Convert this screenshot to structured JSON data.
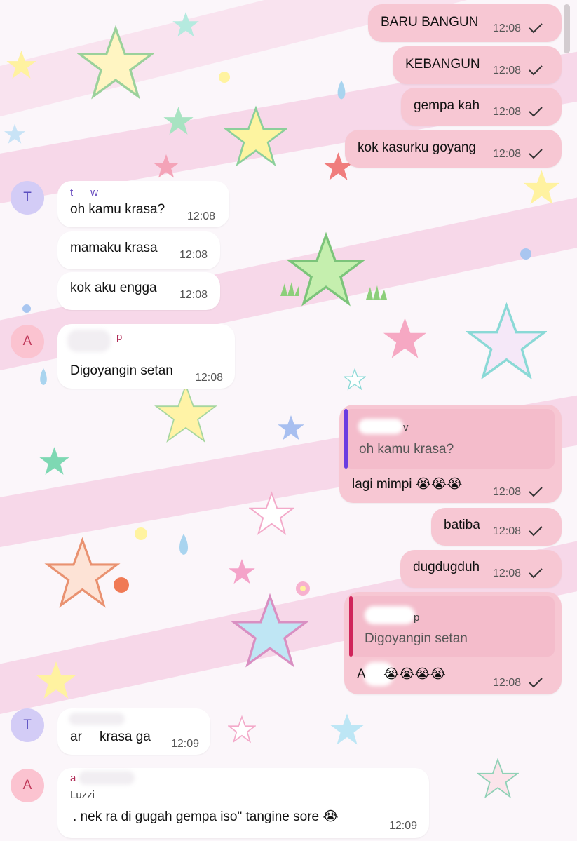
{
  "colors": {
    "outgoing_bubble": "#f7c7d3",
    "incoming_bubble": "#ffffff",
    "quote_bar_1": "#6b3ce0",
    "quote_bar_2": "#d0245a",
    "avatar_t": "#d3ccf6",
    "avatar_a": "#fbc3d0"
  },
  "messages": [
    {
      "id": "m1",
      "direction": "out",
      "text": "BARU BANGUN",
      "time": "12:08",
      "status": "sent-check-icon"
    },
    {
      "id": "m2",
      "direction": "out",
      "text": "KEBANGUN",
      "time": "12:08",
      "status": "sent-check-icon"
    },
    {
      "id": "m3",
      "direction": "out",
      "text": "gempa kah",
      "time": "12:08",
      "status": "sent-check-icon"
    },
    {
      "id": "m4",
      "direction": "out",
      "text": "kok kasurku goyang",
      "time": "12:08",
      "status": "sent-check-icon"
    },
    {
      "id": "m5",
      "direction": "in",
      "avatar": "T",
      "sender": "t      w",
      "text": "oh kamu krasa?",
      "time": "12:08"
    },
    {
      "id": "m6",
      "direction": "in",
      "text": "mamaku krasa",
      "time": "12:08"
    },
    {
      "id": "m7",
      "direction": "in",
      "text": "kok aku engga",
      "time": "12:08"
    },
    {
      "id": "m8",
      "direction": "in",
      "avatar": "A",
      "sender": "p",
      "text": "Digoyangin setan",
      "time": "12:08"
    },
    {
      "id": "m9",
      "direction": "out",
      "quote": {
        "sender": "v",
        "text": "oh kamu krasa?"
      },
      "text": "lagi mimpi 😭😭😭",
      "time": "12:08",
      "status": "sent-check-icon"
    },
    {
      "id": "m10",
      "direction": "out",
      "text": "batiba",
      "time": "12:08",
      "status": "sent-check-icon"
    },
    {
      "id": "m11",
      "direction": "out",
      "text": "dugdugduh",
      "time": "12:08",
      "status": "sent-check-icon"
    },
    {
      "id": "m12",
      "direction": "out",
      "quote": {
        "sender": "p",
        "text": "Digoyangin setan"
      },
      "text": "A     😭😭😭😭",
      "time": "12:08",
      "status": "sent-check-icon"
    },
    {
      "id": "m13",
      "direction": "in",
      "avatar": "T",
      "text_a": "ar",
      "text": "krasa ga",
      "time": "12:09"
    },
    {
      "id": "m14",
      "direction": "in",
      "avatar": "A",
      "sender": "a",
      "sender_line2": "Luzzi",
      "text": ". nek ra di gugah gempa iso\" tangine sore 😭",
      "time": "12:09"
    }
  ]
}
